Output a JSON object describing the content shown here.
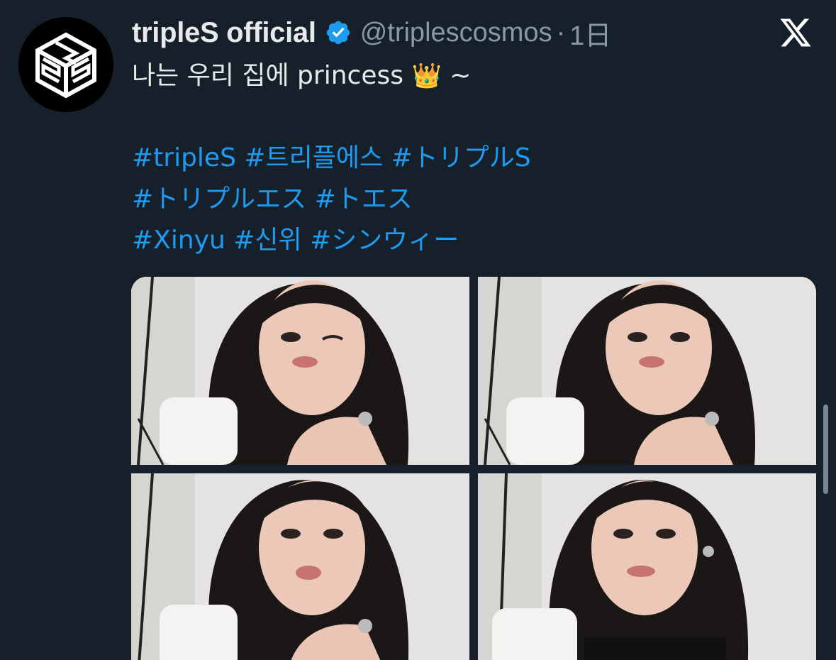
{
  "tweet": {
    "display_name": "tripleS official",
    "handle": "@triplescosmos",
    "separator": "·",
    "time": "1日",
    "verified_icon": "verified-badge-icon",
    "text_line": "나는 우리 집에 princess",
    "emoji": "👑",
    "text_suffix": " ~",
    "hashtag_lines": [
      [
        "#tripleS",
        "#트리플에스",
        "#トリプルS"
      ],
      [
        "#トリプルエス",
        "#トエス"
      ],
      [
        "#Xinyu",
        "#신위",
        "#シンウィー"
      ]
    ]
  },
  "media": {
    "count": 4,
    "photos": [
      {
        "name": "photo-1"
      },
      {
        "name": "photo-2"
      },
      {
        "name": "photo-3"
      },
      {
        "name": "photo-4"
      }
    ]
  },
  "icons": {
    "brand": "x-logo-icon",
    "avatar_logo": "triples-logo-icon"
  },
  "colors": {
    "background": "#15202b",
    "text": "#e7e9ea",
    "secondary": "#8b98a5",
    "link": "#1d9bf0",
    "verified": "#1d9bf0"
  }
}
